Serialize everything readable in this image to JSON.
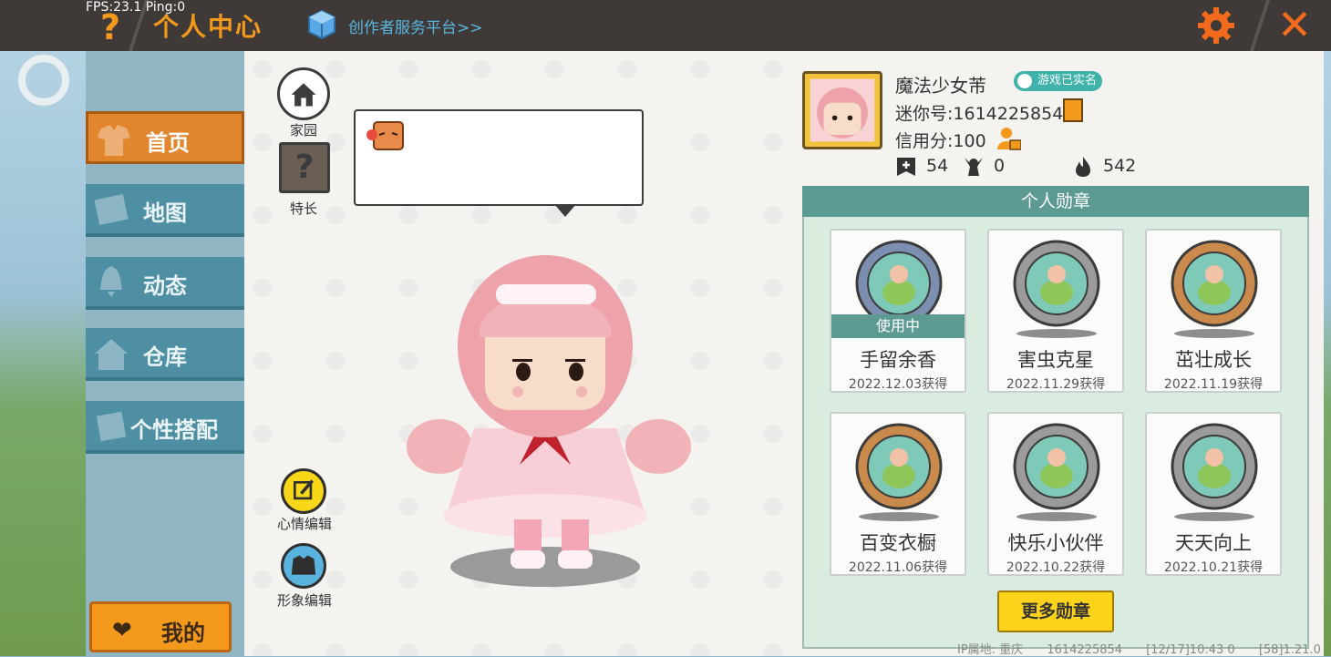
{
  "hud": {
    "fps": "FPS:23.1  Ping:0"
  },
  "header": {
    "help_symbol": "?",
    "title": "个人中心",
    "creator_link": "创作者服务平台>>",
    "close_symbol": "✕"
  },
  "sidebar": {
    "items": [
      {
        "label": "首页",
        "icon": "shirt-icon",
        "active": true
      },
      {
        "label": "地图",
        "icon": "map-icon",
        "active": false
      },
      {
        "label": "动态",
        "icon": "bell-icon",
        "active": false
      },
      {
        "label": "仓库",
        "icon": "house-icon",
        "active": false
      },
      {
        "label": "个性搭配",
        "icon": "dress-up-icon",
        "active": false
      }
    ],
    "mine_label": "我的"
  },
  "stage": {
    "home_label": "家园",
    "skill_label": "特长",
    "skill_symbol": "?",
    "mood_edit_label": "心情编辑",
    "look_edit_label": "形象编辑"
  },
  "profile": {
    "nickname": "魔法少女芾",
    "verified_label": "游戏已实名",
    "uid": "迷你号:1614225854",
    "credit": "信用分:100",
    "stats": [
      {
        "icon": "plus-flag-icon",
        "value": "54"
      },
      {
        "icon": "fans-icon",
        "value": "0"
      },
      {
        "icon": "flame-icon",
        "value": "542"
      }
    ]
  },
  "badges": {
    "header": "个人勋章",
    "using_label": "使用中",
    "items": [
      {
        "name": "手留余香",
        "date": "2022.12.03获得",
        "in_use": true,
        "rim": "#7d8fb0"
      },
      {
        "name": "害虫克星",
        "date": "2022.11.29获得",
        "in_use": false,
        "rim": "#9b9b9b"
      },
      {
        "name": "茁壮成长",
        "date": "2022.11.19获得",
        "in_use": false,
        "rim": "#c98a4c"
      },
      {
        "name": "百变衣橱",
        "date": "2022.11.06获得",
        "in_use": false,
        "rim": "#c98a4c"
      },
      {
        "name": "快乐小伙伴",
        "date": "2022.10.22获得",
        "in_use": false,
        "rim": "#9b9b9b"
      },
      {
        "name": "天天向上",
        "date": "2022.10.21获得",
        "in_use": false,
        "rim": "#9b9b9b"
      }
    ],
    "more_label": "更多勋章"
  },
  "footer": {
    "ip": "IP属地: 重庆",
    "uid": "1614225854",
    "time": "[12/17]10:43 0",
    "version": "[58]1.21.0"
  },
  "colors": {
    "accent": "#f39a1c",
    "teal": "#5c9b92",
    "sidebar": "#4e8fa3"
  }
}
